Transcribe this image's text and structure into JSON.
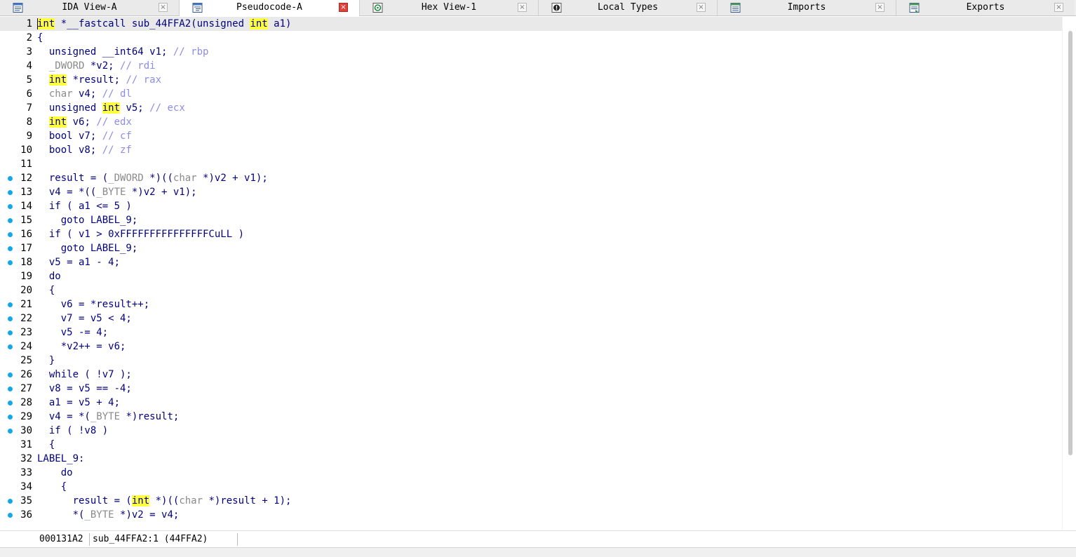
{
  "tabs": [
    {
      "label": "IDA View-A",
      "icon": "disassembly-icon",
      "active": false
    },
    {
      "label": "Pseudocode-A",
      "icon": "pseudocode-icon",
      "active": true
    },
    {
      "label": "Hex View-1",
      "icon": "hex-icon",
      "active": false
    },
    {
      "label": "Local Types",
      "icon": "local-types-icon",
      "active": false
    },
    {
      "label": "Imports",
      "icon": "imports-icon",
      "active": false
    },
    {
      "label": "Exports",
      "icon": "exports-icon",
      "active": false
    }
  ],
  "close_glyph": "×",
  "code_lines": [
    {
      "n": "1",
      "bp": false,
      "text": "int *__fastcall sub_44FFA2(unsigned int a1)"
    },
    {
      "n": "2",
      "bp": false,
      "text": "{"
    },
    {
      "n": "3",
      "bp": false,
      "text": "  unsigned __int64 v1; // rbp"
    },
    {
      "n": "4",
      "bp": false,
      "text": "  _DWORD *v2; // rdi"
    },
    {
      "n": "5",
      "bp": false,
      "text": "  int *result; // rax"
    },
    {
      "n": "6",
      "bp": false,
      "text": "  char v4; // dl"
    },
    {
      "n": "7",
      "bp": false,
      "text": "  unsigned int v5; // ecx"
    },
    {
      "n": "8",
      "bp": false,
      "text": "  int v6; // edx"
    },
    {
      "n": "9",
      "bp": false,
      "text": "  bool v7; // cf"
    },
    {
      "n": "10",
      "bp": false,
      "text": "  bool v8; // zf"
    },
    {
      "n": "11",
      "bp": false,
      "text": ""
    },
    {
      "n": "12",
      "bp": true,
      "text": "  result = (_DWORD *)((char *)v2 + v1);"
    },
    {
      "n": "13",
      "bp": true,
      "text": "  v4 = *((_BYTE *)v2 + v1);"
    },
    {
      "n": "14",
      "bp": true,
      "text": "  if ( a1 <= 5 )"
    },
    {
      "n": "15",
      "bp": true,
      "text": "    goto LABEL_9;"
    },
    {
      "n": "16",
      "bp": true,
      "text": "  if ( v1 > 0xFFFFFFFFFFFFFFFCuLL )"
    },
    {
      "n": "17",
      "bp": true,
      "text": "    goto LABEL_9;"
    },
    {
      "n": "18",
      "bp": true,
      "text": "  v5 = a1 - 4;"
    },
    {
      "n": "19",
      "bp": false,
      "text": "  do"
    },
    {
      "n": "20",
      "bp": false,
      "text": "  {"
    },
    {
      "n": "21",
      "bp": true,
      "text": "    v6 = *result++;"
    },
    {
      "n": "22",
      "bp": true,
      "text": "    v7 = v5 < 4;"
    },
    {
      "n": "23",
      "bp": true,
      "text": "    v5 -= 4;"
    },
    {
      "n": "24",
      "bp": true,
      "text": "    *v2++ = v6;"
    },
    {
      "n": "25",
      "bp": false,
      "text": "  }"
    },
    {
      "n": "26",
      "bp": true,
      "text": "  while ( !v7 );"
    },
    {
      "n": "27",
      "bp": true,
      "text": "  v8 = v5 == -4;"
    },
    {
      "n": "28",
      "bp": true,
      "text": "  a1 = v5 + 4;"
    },
    {
      "n": "29",
      "bp": true,
      "text": "  v4 = *(_BYTE *)result;"
    },
    {
      "n": "30",
      "bp": true,
      "text": "  if ( !v8 )"
    },
    {
      "n": "31",
      "bp": false,
      "text": "  {"
    },
    {
      "n": "32",
      "bp": false,
      "text": "LABEL_9:"
    },
    {
      "n": "33",
      "bp": false,
      "text": "    do"
    },
    {
      "n": "34",
      "bp": false,
      "text": "    {"
    },
    {
      "n": "35",
      "bp": true,
      "text": "      result = (int *)((char *)result + 1);"
    },
    {
      "n": "36",
      "bp": true,
      "text": "      *(_BYTE *)v2 = v4;"
    }
  ],
  "status": {
    "address": "000131A2",
    "location": "sub_44FFA2:1 (44FFA2)"
  },
  "colors": {
    "keyword": "#000080",
    "comment": "#8c8ce6",
    "highlight": "#ffff40",
    "breakpoint_dot": "#11a7e8",
    "active_tab_close": "#e0423a"
  }
}
